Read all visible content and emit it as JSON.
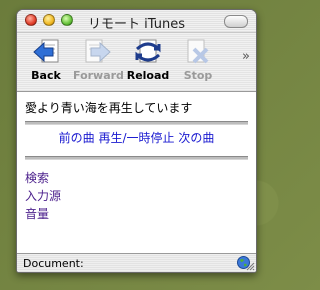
{
  "window": {
    "title": "リモート iTunes"
  },
  "toolbar": {
    "back_label": "Back",
    "forward_label": "Forward",
    "reload_label": "Reload",
    "stop_label": "Stop",
    "overflow_glyph": "»"
  },
  "content": {
    "now_playing": "愛より青い海を再生しています",
    "controls": {
      "prev": "前の曲",
      "play_pause": "再生/一時停止",
      "next": "次の曲"
    },
    "links": [
      "検索",
      "入力源",
      "音量"
    ]
  },
  "statusbar": {
    "label": "Document:"
  },
  "colors": {
    "link_blue": "#1a1ad0",
    "visited_purple": "#4b1f8c",
    "desktop_green": "#6e7f3f"
  }
}
